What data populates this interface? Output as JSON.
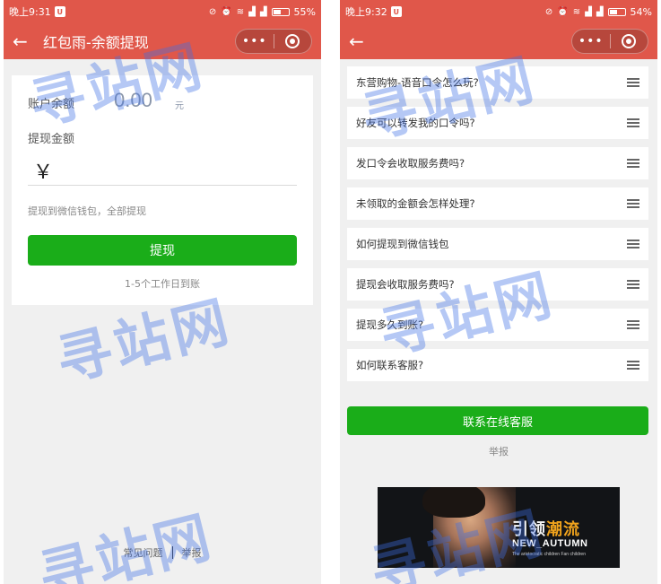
{
  "left_screen": {
    "status": {
      "time": "晚上9:31",
      "battery": "55%",
      "battery_level": 0.55
    },
    "nav": {
      "back_glyph": "←",
      "title": "红包雨-余额提现",
      "more_glyph": "•••"
    },
    "balance_label": "账户余额",
    "balance_value": "0.00",
    "balance_unit": "元",
    "withdraw_label": "提现金额",
    "currency_symbol": "￥",
    "hint": "提现到微信钱包，全部提现",
    "withdraw_button": "提现",
    "arrival_note": "1-5个工作日到账",
    "footer": {
      "faq_link": "常见问题",
      "report_link": "举报"
    }
  },
  "right_screen": {
    "status": {
      "time": "晚上9:32",
      "battery": "54%",
      "battery_level": 0.54
    },
    "nav": {
      "back_glyph": "←",
      "more_glyph": "•••"
    },
    "faq_items": [
      "东营购物-语音口令怎么玩?",
      "好友可以转发我的口令吗?",
      "发口令会收取服务费吗?",
      "未领取的金额会怎样处理?",
      "如何提现到微信钱包",
      "提现会收取服务费吗?",
      "提现多久到账?",
      "如何联系客服?"
    ],
    "service_button": "联系在线客服",
    "report_link": "举报",
    "ad": {
      "headline_white": "引领",
      "headline_orange": "潮流",
      "subline": "NEW_AUTUMN",
      "fine_print": "The aristocratic children Fan children"
    }
  },
  "watermark": "寻站网",
  "colors": {
    "header": "#e0574a",
    "primary_button": "#1aad19",
    "background": "#f0f0f0",
    "ad_accent": "#f0a31c"
  },
  "icons": [
    "back-arrow-icon",
    "more-dots-icon",
    "close-target-icon",
    "menu-lines-icon",
    "wifi-icon",
    "signal-icon",
    "battery-icon",
    "alarm-icon"
  ]
}
